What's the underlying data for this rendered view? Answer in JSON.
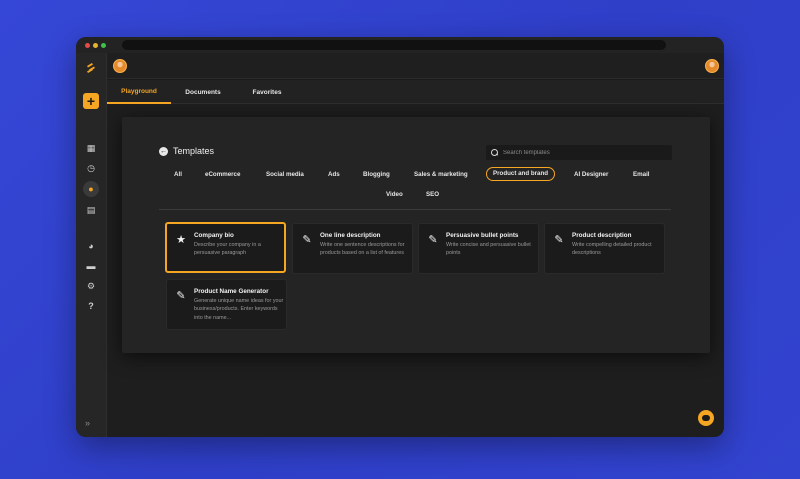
{
  "browser": {
    "controls": [
      "close",
      "minimize",
      "maximize"
    ]
  },
  "sidebar": {
    "logo_icon": "logo-icon",
    "add_label": "+",
    "items": [
      {
        "name": "dashboard-icon",
        "glyph": "▦"
      },
      {
        "name": "history-icon",
        "glyph": "◷"
      },
      {
        "name": "brand-voice-icon",
        "glyph": "●"
      },
      {
        "name": "calendar-icon",
        "glyph": "▤"
      },
      {
        "name": "palette-icon",
        "glyph": "◕"
      },
      {
        "name": "folder-icon",
        "glyph": "▬"
      },
      {
        "name": "settings-icon",
        "glyph": "⚙"
      },
      {
        "name": "help-icon",
        "glyph": "?"
      }
    ],
    "expand_glyph": "»"
  },
  "tabs": [
    {
      "label": "Playground",
      "active": true
    },
    {
      "label": "Documents",
      "active": false
    },
    {
      "label": "Favorites",
      "active": false
    }
  ],
  "templates": {
    "title": "Templates",
    "search_placeholder": "Search templates",
    "categories": [
      {
        "label": "All",
        "selected": false
      },
      {
        "label": "eCommerce",
        "selected": false
      },
      {
        "label": "Social media",
        "selected": false
      },
      {
        "label": "Ads",
        "selected": false
      },
      {
        "label": "Blogging",
        "selected": false
      },
      {
        "label": "Sales & marketing",
        "selected": false
      },
      {
        "label": "Product and brand",
        "selected": true
      },
      {
        "label": "AI Designer",
        "selected": false
      },
      {
        "label": "Email",
        "selected": false
      },
      {
        "label": "Video",
        "selected": false
      },
      {
        "label": "SEO",
        "selected": false
      }
    ],
    "cards": [
      {
        "title": "Company bio",
        "description": "Describe your company in a persuasive paragraph",
        "icon": "star-icon",
        "selected": true
      },
      {
        "title": "One line description",
        "description": "Write one sentence descriptions for products based on a list of features",
        "icon": "pencil-icon",
        "selected": false
      },
      {
        "title": "Persuasive bullet points",
        "description": "Write concise and persuasive bullet points",
        "icon": "pencil-icon",
        "selected": false
      },
      {
        "title": "Product description",
        "description": "Write compelling detailed product descriptions",
        "icon": "pencil-icon",
        "selected": false
      },
      {
        "title": "Product Name Generator",
        "description": "Generate unique name ideas for your business/products. Enter keywords into the name...",
        "icon": "pencil-icon",
        "selected": false
      }
    ]
  },
  "colors": {
    "accent": "#f5a623",
    "background": "#3547d6",
    "panel": "#242424"
  }
}
